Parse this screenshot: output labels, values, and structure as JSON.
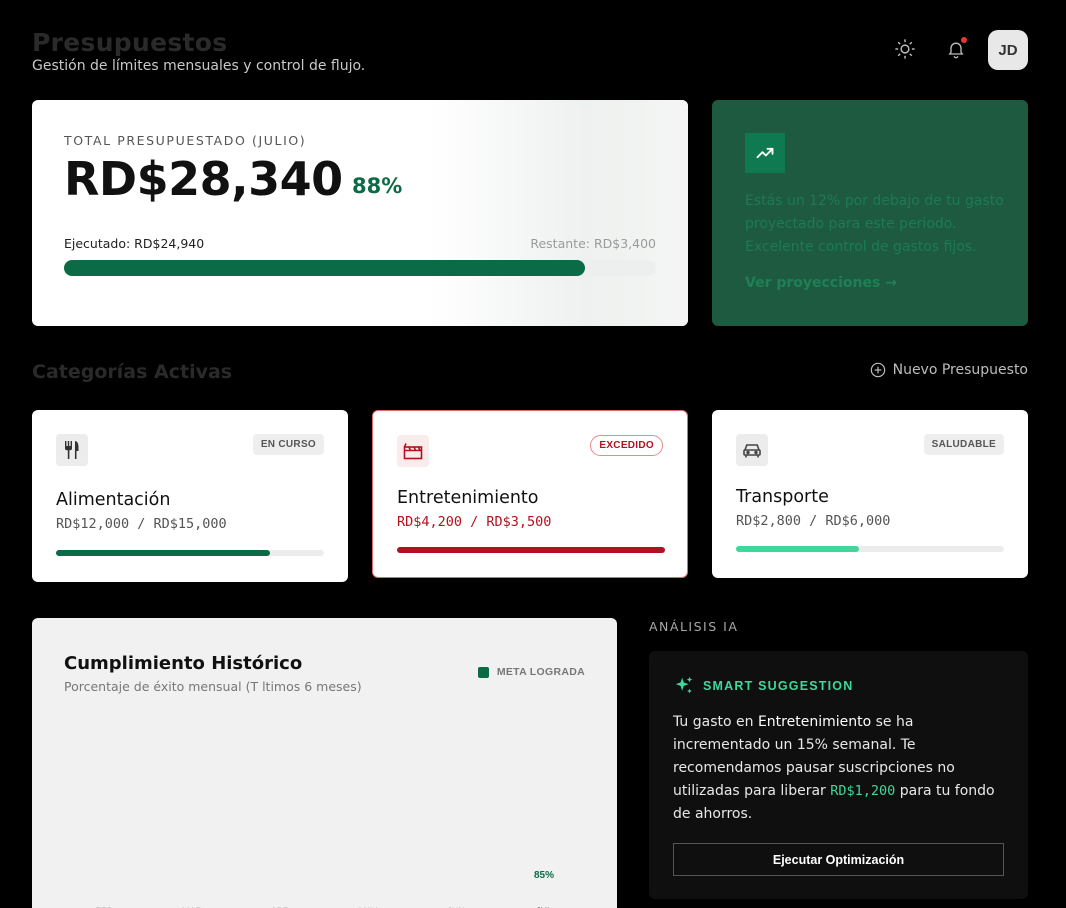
{
  "header": {
    "title": "Presupuestos",
    "subtitle": "Gestión de límites mensuales y control de flujo.",
    "avatar_initials": "JD",
    "icons": [
      "sun-icon",
      "bell-icon"
    ]
  },
  "total": {
    "label": "TOTAL PRESUPUESTADO (JULIO)",
    "amount": "RD$28,340",
    "percent_label": "88%",
    "executed_label": "Ejecutado: RD$24,940",
    "remaining_label": "Restante: RD$3,400",
    "progress": 0.88
  },
  "insight": {
    "icon": "trending-up-icon",
    "text": "Estás un 12% por debajo de tu gasto proyectado para este periodo. Excelente control de gastos fijos.",
    "link": "Ver proyecciones →"
  },
  "categories_section": {
    "title": "Categorías Activas",
    "new_button": "Nuevo Presupuesto"
  },
  "categories": [
    {
      "name": "Alimentación",
      "amount": "RD$12,000 / RD$15,000",
      "badge": "EN CURSO",
      "progress": 0.8,
      "color": "#0b6b47",
      "icon": "utensils-icon"
    },
    {
      "name": "Entretenimiento",
      "amount": "RD$4,200 / RD$3,500",
      "badge": "EXCEDIDO",
      "progress": 1.0,
      "color": "#b2111f",
      "icon": "clapperboard-icon"
    },
    {
      "name": "Transporte",
      "amount": "RD$2,800 / RD$6,000",
      "badge": "SALUDABLE",
      "progress": 0.46,
      "color": "#3fd79b",
      "icon": "car-icon"
    }
  ],
  "history": {
    "title": "Cumplimiento Histórico",
    "subtitle": "Porcentaje de éxito mensual (T ltimos 6 meses)",
    "legend": "META LOGRADA"
  },
  "chart_data": {
    "type": "bar",
    "title": "Cumplimiento Histórico",
    "categories": [
      "FEB",
      "MAR",
      "ABR",
      "MAY",
      "JUN",
      "JUL"
    ],
    "series": [
      {
        "name": "META LOGRADA",
        "values": [
          null,
          null,
          null,
          null,
          null,
          85
        ]
      }
    ],
    "data_labels": [
      "",
      "",
      "",
      "",
      "",
      "85%"
    ],
    "legend_position": "top-right",
    "grid": false
  },
  "ai": {
    "section_label": "ANÁLISIS IA",
    "heading": "SMART SUGGESTION",
    "text_1": "Tu gasto en ",
    "highlight": "Entretenimiento",
    "text_2": " se ha incrementado un 15% semanal. Te recomendamos pausar suscripciones no utilizadas para liberar ",
    "amount": "RD$1,200",
    "text_3": " para tu fondo de ahorros.",
    "button": "Ejecutar Optimización"
  },
  "colors": {
    "accent": "#0b6b47",
    "danger": "#b2111f",
    "mint": "#3fd79b"
  }
}
